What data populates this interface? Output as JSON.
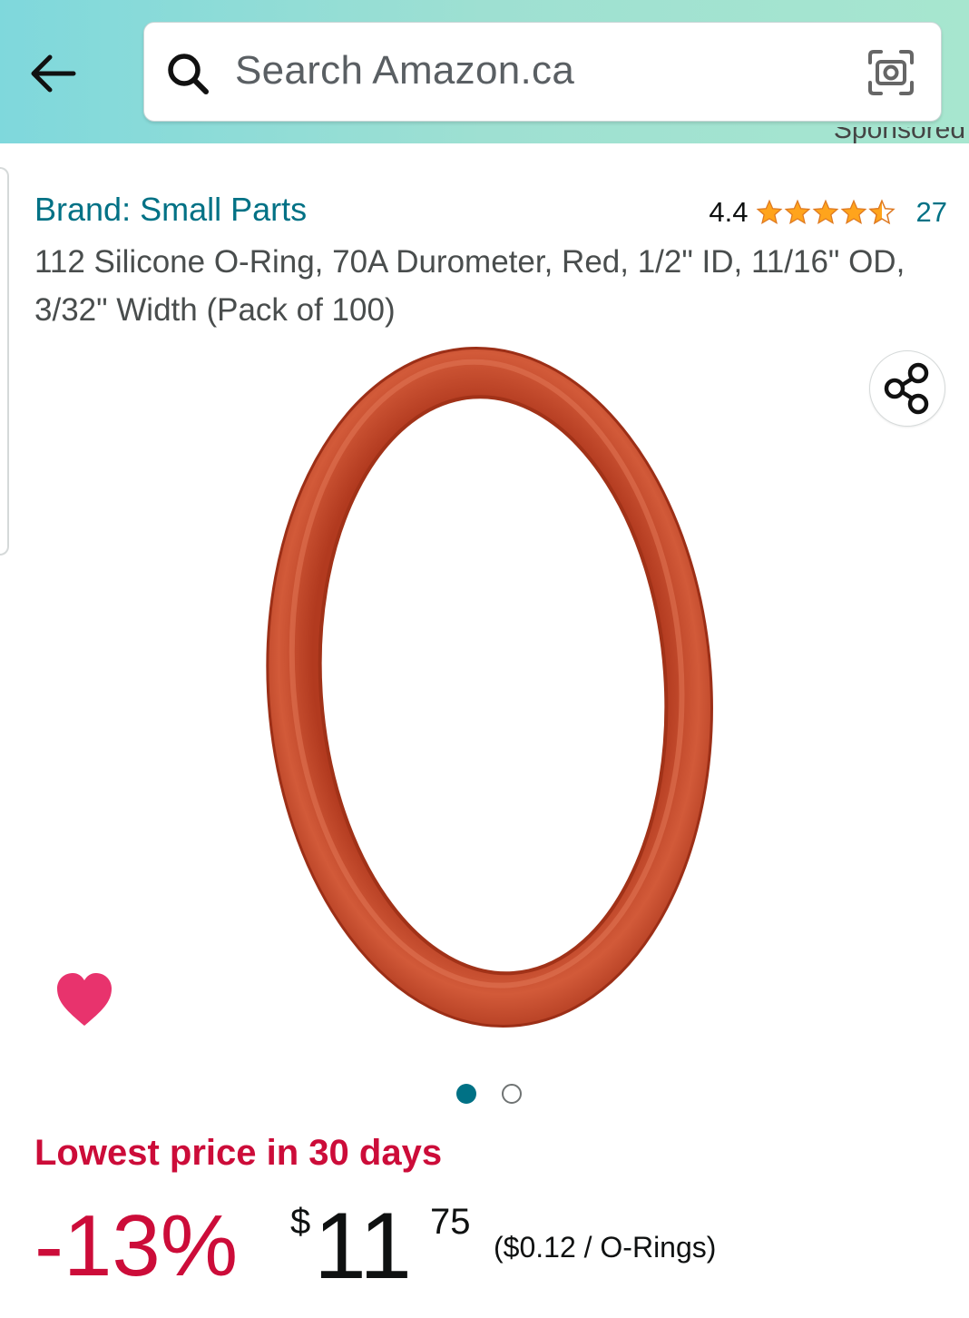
{
  "search": {
    "placeholder": "Search Amazon.ca"
  },
  "header": {
    "back_icon": "arrow-left-icon",
    "search_icon": "magnifier-icon",
    "lens_icon": "camera-lens-icon"
  },
  "sponsored": "Sponsored",
  "product": {
    "brand": "Brand: Small Parts",
    "rating": "4.4",
    "rating_stars": 4.4,
    "rating_count": "27",
    "title": "112 Silicone O-Ring, 70A Durometer, Red, 1/2\" ID, 11/16\" OD, 3/32\" Width (Pack of 100)",
    "image_count": 2,
    "image_index": 1
  },
  "deal": {
    "label": "Lowest price in 30 days",
    "discount": "-13%",
    "currency": "$",
    "price_whole": "11",
    "price_fraction": "75",
    "unit_price": "($0.12 / O-Rings)"
  },
  "colors": {
    "brand_link": "#007185",
    "deal_red": "#cc0c39",
    "star": "#ffa41c",
    "heart": "#e8336d",
    "ring": "#c94a2b"
  }
}
